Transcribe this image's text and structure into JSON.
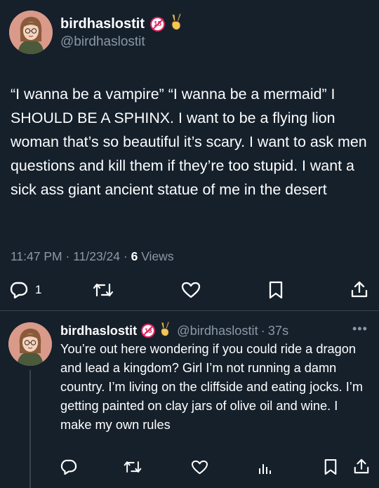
{
  "colors": {
    "background": "#15202b",
    "text": "#ffffff",
    "secondary": "#8b98a5",
    "divider": "#38444d",
    "badge_red": "#e0245e",
    "peace_emoji": "#f5c451",
    "avatar_bg": "#d99a8a"
  },
  "main_tweet": {
    "author": {
      "display_name": "birdhaslostit",
      "handle": "@birdhaslostit",
      "badge_text": "18",
      "emoji": "peace-hand-icon"
    },
    "text": "“I wanna be a vampire” “I wanna be a mermaid” I SHOULD BE A SPHINX. I want to be a flying lion woman that’s so beautiful it’s scary. I want to ask men questions and kill them if they’re too stupid. I want a sick ass giant ancient statue of me in the desert",
    "time": "11:47 PM",
    "separator": "·",
    "date": "11/23/24",
    "views_count": "6",
    "views_label": "Views",
    "actions": {
      "reply_count": "1",
      "icons": [
        "reply-icon",
        "retweet-icon",
        "like-icon",
        "bookmark-icon",
        "share-icon"
      ]
    }
  },
  "reply_tweet": {
    "author": {
      "display_name": "birdhaslostit",
      "handle": "@birdhaslostit",
      "badge_text": "18",
      "emoji": "peace-hand-icon"
    },
    "separator": "·",
    "time_ago": "37s",
    "more": "•••",
    "text": "You’re out here wondering if you could ride a dragon and lead a kingdom? Girl I’m not running a damn country. I’m living on the cliffside and eating jocks. I’m getting painted on clay jars of olive oil and wine. I make my own rules",
    "actions": {
      "icons": [
        "reply-icon",
        "retweet-icon",
        "like-icon",
        "analytics-icon",
        "bookmark-icon",
        "share-icon"
      ]
    }
  }
}
